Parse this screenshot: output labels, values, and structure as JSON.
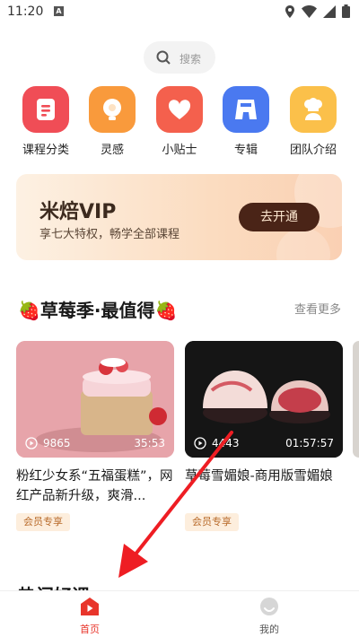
{
  "status": {
    "time": "11:20",
    "a_badge": "A"
  },
  "search": {
    "placeholder": "搜索"
  },
  "categories": [
    {
      "label": "课程分类",
      "icon": "document-icon",
      "color": "#f04d56"
    },
    {
      "label": "灵感",
      "icon": "bulb-icon",
      "color": "#f99a3c"
    },
    {
      "label": "小贴士",
      "icon": "heart-icon",
      "color": "#f4604d"
    },
    {
      "label": "专辑",
      "icon": "album-icon",
      "color": "#4a79f0"
    },
    {
      "label": "团队介绍",
      "icon": "chef-icon",
      "color": "#fbc04a"
    }
  ],
  "vip": {
    "title": "米焙VIP",
    "subtitle": "享七大特权，畅学全部课程",
    "button": "去开通"
  },
  "section": {
    "title": "🍓草莓季·最值得🍓",
    "more": "查看更多"
  },
  "cards": [
    {
      "views": "9865",
      "duration": "35:53",
      "title": "粉红少女系“五福蛋糕”，网红产品新升级，爽滑...",
      "badge": "会员专享"
    },
    {
      "views": "4443",
      "duration": "01:57:57",
      "title": "草莓雪媚娘-商用版雪媚娘",
      "badge": "会员专享"
    }
  ],
  "hot": {
    "title": "热门好课"
  },
  "tabs": [
    {
      "label": "首页",
      "active": true
    },
    {
      "label": "我的",
      "active": false
    }
  ],
  "colors": {
    "accent": "#e8352b",
    "vip_button": "#4a2417",
    "badge_bg": "#fdeedd"
  }
}
